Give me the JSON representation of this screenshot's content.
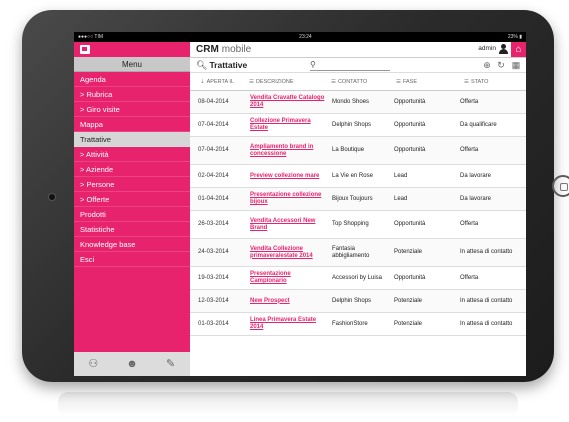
{
  "status": {
    "left": "●●●○○ TIM",
    "time": "23:24",
    "right": "23% ▮"
  },
  "app": {
    "brand_bold": "CRM",
    "brand_light": "mobile",
    "admin": "admin"
  },
  "menu": {
    "header": "Menu",
    "items": [
      {
        "label": "Agenda",
        "sub": false,
        "active": false
      },
      {
        "label": "> Rubrica",
        "sub": true,
        "active": false
      },
      {
        "label": "> Giro visite",
        "sub": true,
        "active": false
      },
      {
        "label": "Mappa",
        "sub": false,
        "active": false
      },
      {
        "label": "Trattative",
        "sub": false,
        "active": true
      },
      {
        "label": "> Attività",
        "sub": true,
        "active": false
      },
      {
        "label": "> Aziende",
        "sub": true,
        "active": false
      },
      {
        "label": "> Persone",
        "sub": true,
        "active": false
      },
      {
        "label": "> Offerte",
        "sub": true,
        "active": false
      },
      {
        "label": "Prodotti",
        "sub": false,
        "active": false
      },
      {
        "label": "Statistiche",
        "sub": false,
        "active": false
      },
      {
        "label": "Knowledge base",
        "sub": false,
        "active": false
      },
      {
        "label": "Esci",
        "sub": false,
        "active": false
      }
    ]
  },
  "toolbar": {
    "title": "Trattative"
  },
  "table": {
    "headers": [
      "APERTA IL",
      "DESCRIZIONE",
      "CONTATTO",
      "FASE",
      "STATO"
    ],
    "rows": [
      {
        "date": "08-04-2014",
        "desc": "Vendita Cravatte Catalogo 2014",
        "contact": "Mondo Shoes",
        "phase": "Opportunità",
        "state": "Offerta",
        "size": "tall"
      },
      {
        "date": "07-04-2014",
        "desc": "Collezione Primavera Estate",
        "contact": "Delphin Shops",
        "phase": "Opportunità",
        "state": "Da qualificare",
        "size": "tall"
      },
      {
        "date": "07-04-2014",
        "desc": "Ampliamento brand in concessione",
        "contact": "La Boutique",
        "phase": "Opportunità",
        "state": "Offerta",
        "size": "taller"
      },
      {
        "date": "02-04-2014",
        "desc": "Preview collezione mare",
        "contact": "La Vie en Rose",
        "phase": "Lead",
        "state": "Da lavorare",
        "size": "tall"
      },
      {
        "date": "01-04-2014",
        "desc": "Presentazione collezione bijoux",
        "contact": "Bijoux Toujours",
        "phase": "Lead",
        "state": "Da lavorare",
        "size": "tall"
      },
      {
        "date": "26-03-2014",
        "desc": "Vendita Accessori New Brand",
        "contact": "Top Shopping",
        "phase": "Opportunità",
        "state": "Offerta",
        "size": "taller"
      },
      {
        "date": "24-03-2014",
        "desc": "Vendita Collezione primavera/estate 2014",
        "contact": "Fantasia abbigliamento",
        "phase": "Potenziale",
        "state": "In attesa di contatto",
        "size": "taller"
      },
      {
        "date": "19-03-2014",
        "desc": "Presentazione Campionario",
        "contact": "Accessori by Luisa",
        "phase": "Opportunità",
        "state": "Offerta",
        "size": "tall"
      },
      {
        "date": "12-03-2014",
        "desc": "New Prospect",
        "contact": "Delphin Shops",
        "phase": "Potenziale",
        "state": "In attesa di contatto",
        "size": "tall"
      },
      {
        "date": "01-03-2014",
        "desc": "Linea Primavera Estate 2014",
        "contact": "FashionStore",
        "phase": "Potenziale",
        "state": "In attesa di contatto",
        "size": "tall"
      }
    ]
  }
}
